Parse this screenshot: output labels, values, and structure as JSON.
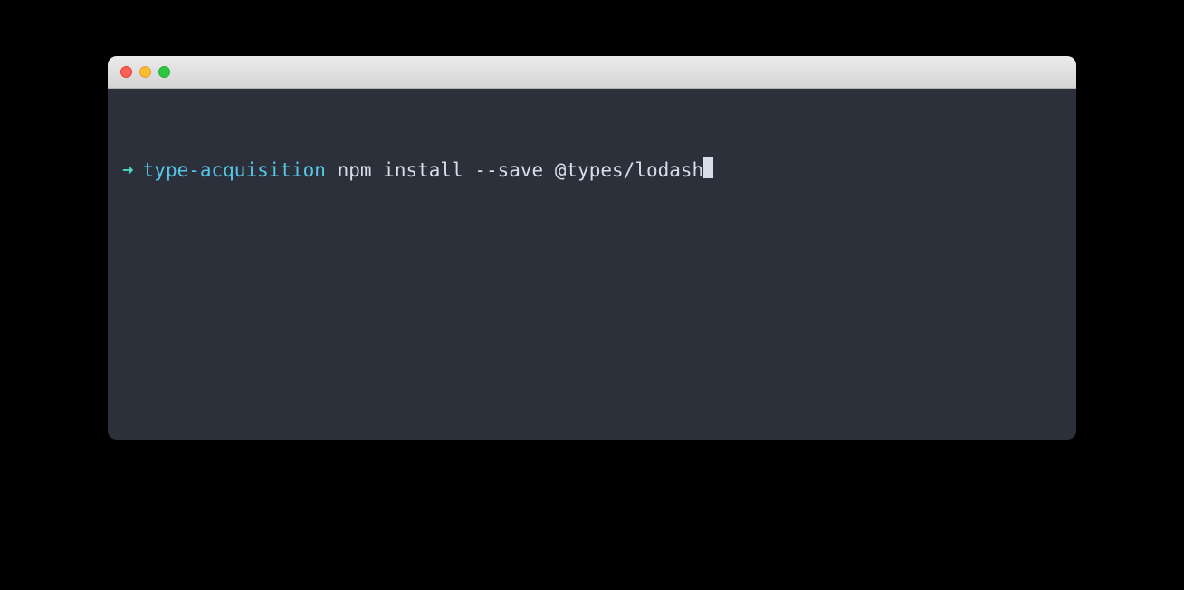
{
  "terminal": {
    "prompt": {
      "arrow": "➜",
      "cwd": "type-acquisition",
      "command": "npm install --save @types/lodash"
    },
    "colors": {
      "background": "#2b303b",
      "foreground": "#d8dee9",
      "arrow": "#4fd6be",
      "cwd": "#56c7e8"
    },
    "traffic_lights": {
      "close": "close",
      "minimize": "minimize",
      "zoom": "zoom"
    }
  }
}
